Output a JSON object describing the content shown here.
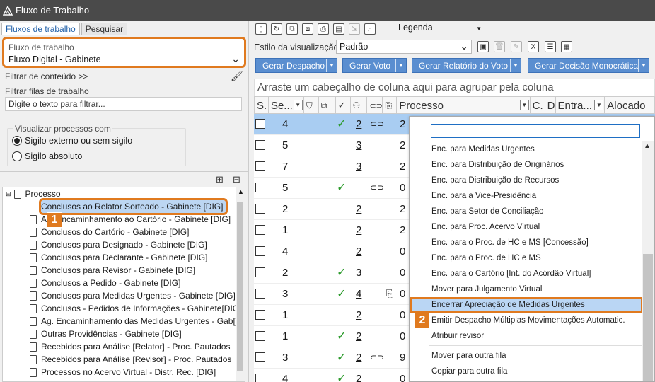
{
  "window": {
    "title": "Fluxo de Trabalho"
  },
  "left": {
    "tabs": [
      "Fluxos de trabalho",
      "Pesquisar"
    ],
    "flow_label": "Fluxo de trabalho",
    "flow_value": "Fluxo Digital - Gabinete",
    "content_filter": "Filtrar de conteúdo >>",
    "queue_filter_label": "Filtrar filas de trabalho",
    "queue_filter_placeholder": "Digite o texto para filtrar...",
    "visibility_legend": "Visualizar processos com",
    "radio_1": "Sigilo externo ou sem sigilo",
    "radio_2": "Sigilo absoluto",
    "tree_root": "Processo",
    "tree_items": [
      "Conclusos ao Relator Sorteado - Gabinete [DIG]",
      "Ag. Encaminhamento ao Cartório - Gabinete [DIG]",
      "Conclusos do Cartório - Gabinete [DIG]",
      "Conclusos para Designado - Gabinete [DIG]",
      "Conclusos para Declarante - Gabinete [DIG]",
      "Conclusos para Revisor - Gabinete [DIG]",
      "Conclusos a Pedido - Gabinete [DIG]",
      "Conclusos para Medidas Urgentes - Gabinete [DIG]",
      "Conclusos - Pedidos de Informações - Gabinete[DIG]",
      "Ag. Encaminhamento das Medidas Urgentes - Gab[DIG]",
      "Outras Providências - Gabinete [DIG]",
      "Recebidos para Análise [Relator] - Proc. Pautados",
      "Recebidos para Análise [Revisor] - Proc. Pautados",
      "Processos no Acervo Virtual - Distr. Rec. [DIG]"
    ],
    "badge_1": "1"
  },
  "right": {
    "legend": "Legenda",
    "style_label": "Estilo da visualização",
    "style_value": "Padrão",
    "actions": [
      "Gerar Despacho",
      "Gerar Voto",
      "Gerar Relatório do Voto",
      "Gerar Decisão Monocrática"
    ],
    "group_hint": "Arraste um cabeçalho de coluna aqui para agrupar pela coluna",
    "columns": [
      "S.",
      "Se...",
      "Processo",
      "C.",
      "D",
      "Entra...",
      "Alocado"
    ],
    "rows": [
      {
        "seq": "4",
        "chk": "✓",
        "num": "2",
        "lnk": "⊂⊃",
        "clip": "",
        "proc": "2"
      },
      {
        "seq": "5",
        "chk": "",
        "num": "3",
        "lnk": "",
        "clip": "",
        "proc": "2"
      },
      {
        "seq": "7",
        "chk": "",
        "num": "3",
        "lnk": "",
        "clip": "",
        "proc": "2"
      },
      {
        "seq": "5",
        "chk": "✓",
        "num": "",
        "lnk": "⊂⊃",
        "clip": "",
        "proc": "0"
      },
      {
        "seq": "2",
        "chk": "",
        "num": "2",
        "lnk": "",
        "clip": "",
        "proc": "2"
      },
      {
        "seq": "1",
        "chk": "",
        "num": "2",
        "lnk": "",
        "clip": "",
        "proc": "2"
      },
      {
        "seq": "4",
        "chk": "",
        "num": "2",
        "lnk": "",
        "clip": "",
        "proc": "0"
      },
      {
        "seq": "2",
        "chk": "✓",
        "num": "3",
        "lnk": "",
        "clip": "",
        "proc": "0"
      },
      {
        "seq": "3",
        "chk": "✓",
        "num": "4",
        "lnk": "",
        "clip": "⎘",
        "proc": "0"
      },
      {
        "seq": "1",
        "chk": "",
        "num": "2",
        "lnk": "",
        "clip": "",
        "proc": "0"
      },
      {
        "seq": "1",
        "chk": "✓",
        "num": "2",
        "lnk": "",
        "clip": "",
        "proc": "0"
      },
      {
        "seq": "3",
        "chk": "✓",
        "num": "2",
        "lnk": "⊂⊃",
        "clip": "",
        "proc": "9"
      },
      {
        "seq": "4",
        "chk": "✓",
        "num": "2",
        "lnk": "",
        "clip": "",
        "proc": "0"
      }
    ]
  },
  "menu": {
    "items": [
      "Enc. para Medidas Urgentes",
      "Enc. para Distribuição de Originários",
      "Enc. para Distribuição de Recursos",
      "Enc. para a Vice-Presidência",
      "Enc. para Setor de Conciliação",
      "Enc. para Proc. Acervo Virtual",
      "Enc. para o Proc. de HC e MS [Concessão]",
      "Enc. para o Proc. de HC e MS",
      "Enc. para o Cartório [Int. do Acórdão Virtual]",
      "Mover para Julgamento Virtual",
      "Encerrar Apreciação de Medidas Urgentes",
      "Emitir Despacho Múltiplas Movimentações Automatic.",
      "Atribuir revisor",
      "Mover para outra fila",
      "Copiar para outra fila"
    ],
    "badge_2": "2"
  }
}
